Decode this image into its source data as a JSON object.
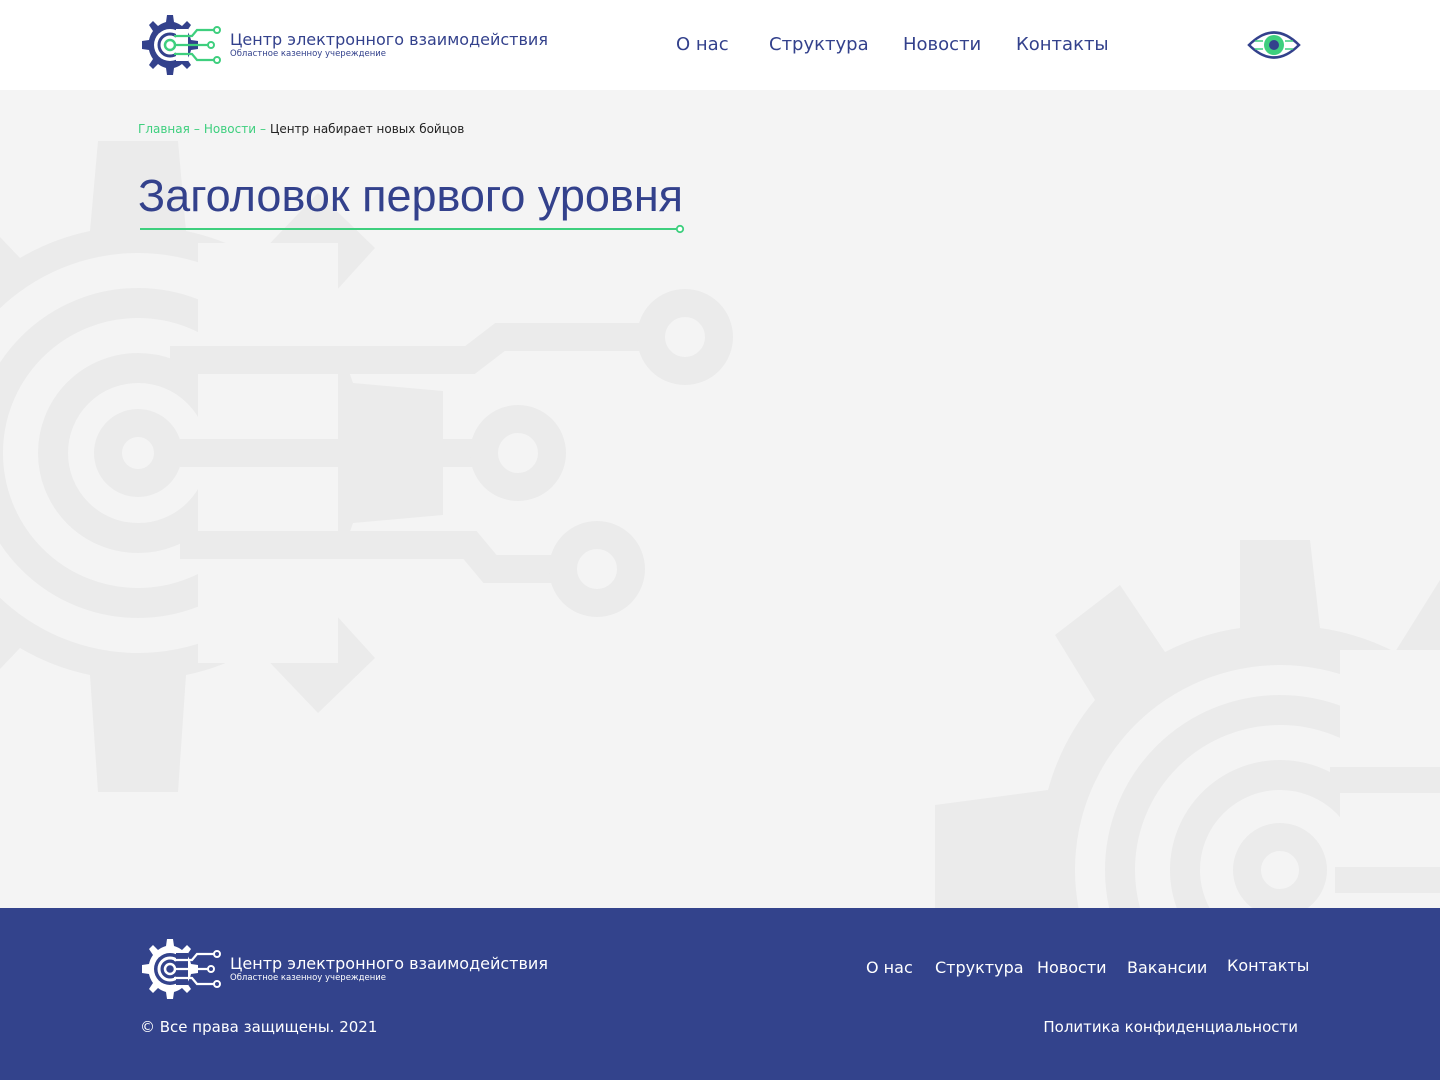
{
  "brand": {
    "title": "Центр электронного взаимодействия",
    "subtitle": "Областное казенноу учереждение"
  },
  "header": {
    "nav": [
      "О нас",
      "Структура",
      "Новости",
      "Контакты"
    ],
    "accessibility_icon": "eye-icon"
  },
  "breadcrumb": {
    "home": "Главная",
    "news": "Новости",
    "separator": "–",
    "current": "Центр набирает новых бойцов"
  },
  "page": {
    "heading": "Заголовок первого уровня"
  },
  "footer": {
    "nav": [
      "О нас",
      "Структура",
      "Новости",
      "Вакансии",
      "Контакты"
    ],
    "copyright": "© Все права защищены. 2021",
    "policy": "Политика конфиденциальности"
  },
  "colors": {
    "primary": "#33418c",
    "accent": "#3ecf7e",
    "background": "#f4f4f4",
    "footer": "#33438c"
  }
}
